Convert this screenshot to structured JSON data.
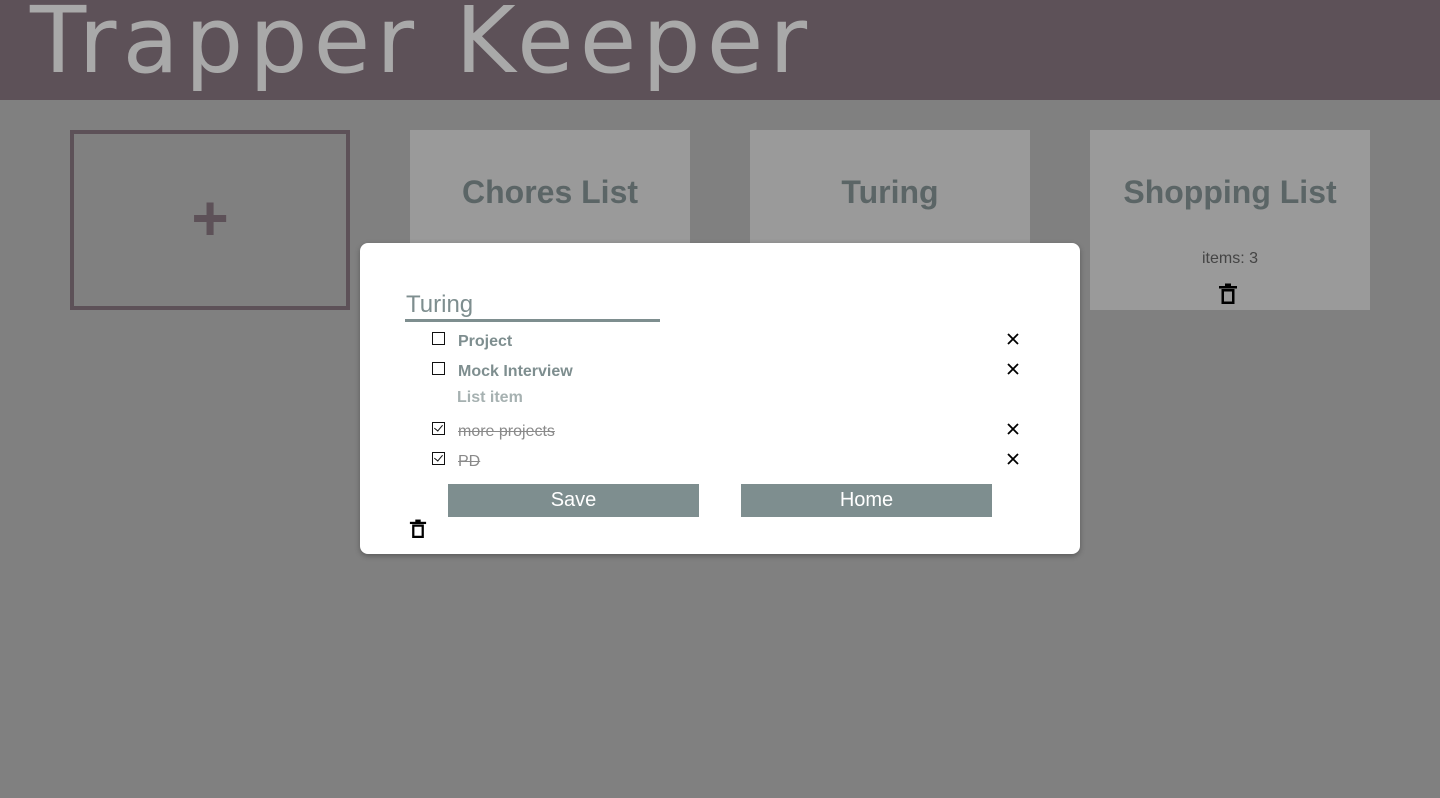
{
  "app": {
    "title": "Trapper Keeper"
  },
  "add_card": {
    "icon": "+"
  },
  "cards": [
    {
      "title": "Chores List"
    },
    {
      "title": "Turing"
    },
    {
      "title": "Shopping List",
      "count_text": "items: 3"
    }
  ],
  "modal": {
    "title_value": "Turing",
    "items": [
      {
        "text": "Project",
        "completed": false
      },
      {
        "text": "Mock Interview",
        "completed": false
      },
      {
        "text": "more projects",
        "completed": true
      },
      {
        "text": "PD",
        "completed": true
      }
    ],
    "new_item_placeholder": "List item",
    "save_label": "Save",
    "home_label": "Home"
  },
  "colors": {
    "header_bg": "#5d5158",
    "title_text": "#a9a9a9",
    "overlay_bg": "#808080",
    "card_bg": "#9a9a9a",
    "accent": "#7e8e8f"
  }
}
